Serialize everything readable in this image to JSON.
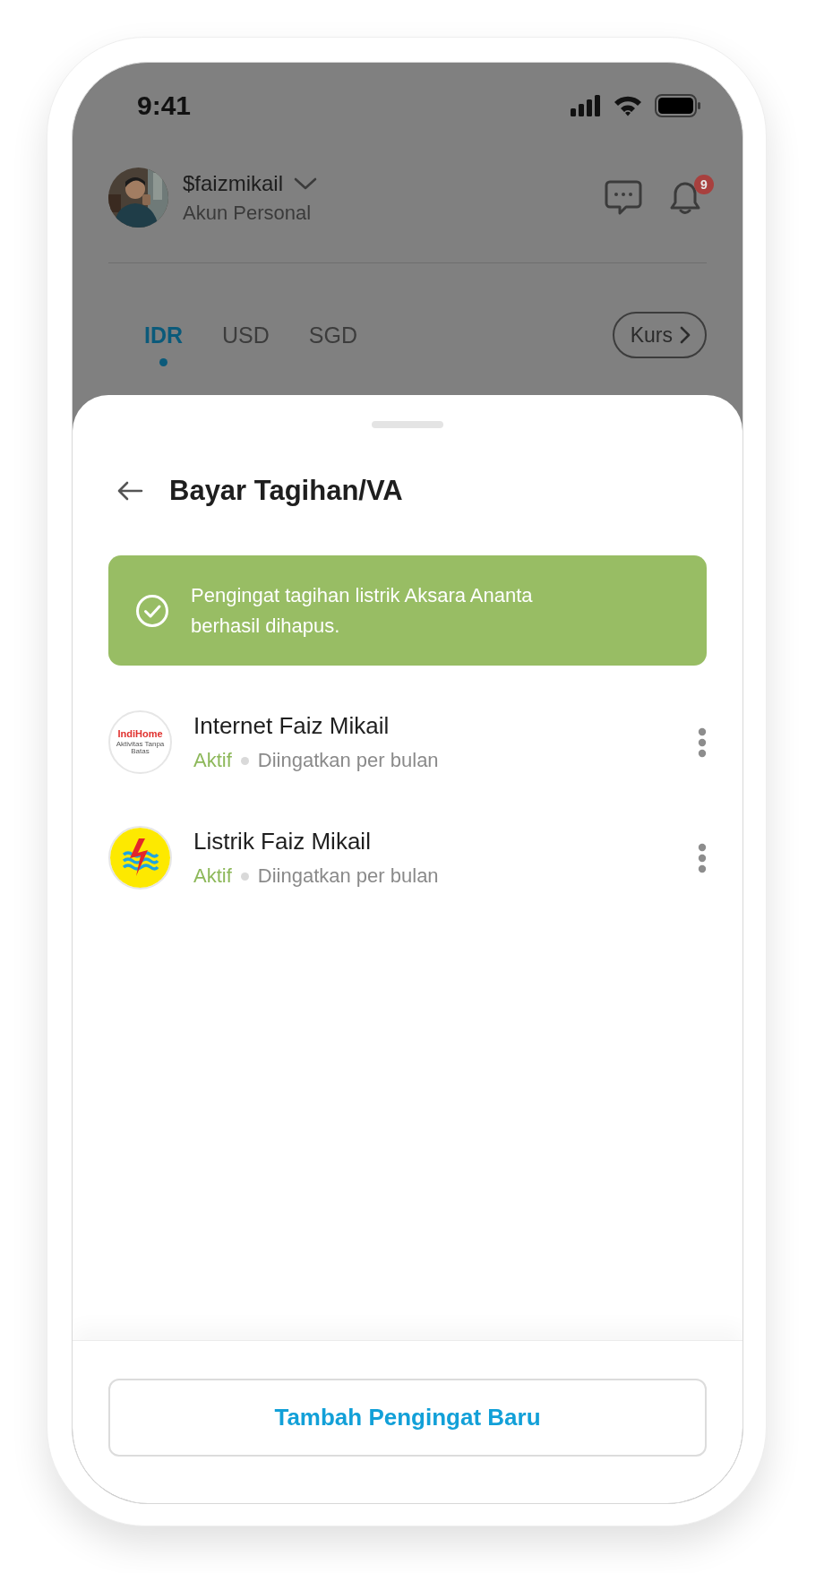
{
  "status_bar": {
    "time": "9:41"
  },
  "account": {
    "username": "$faizmikail",
    "type": "Akun Personal",
    "notification_count": "9"
  },
  "currency_tabs": [
    {
      "label": "IDR",
      "selected": true
    },
    {
      "label": "USD",
      "selected": false
    },
    {
      "label": "SGD",
      "selected": false
    }
  ],
  "rates_button": {
    "label": "Kurs"
  },
  "sheet": {
    "title": "Bayar Tagihan/VA",
    "toast": {
      "message": "Pengingat tagihan listrik Aksara Ananta berhasil dihapus."
    },
    "reminders": [
      {
        "name": "Internet Faiz Mikail",
        "status": "Aktif",
        "active": true,
        "frequency": "Diingatkan per bulan",
        "logo": {
          "kind": "indihome",
          "text": "IndiHome",
          "tagline": "Aktivitas Tanpa Batas"
        }
      },
      {
        "name": "Listrik Faiz Mikail",
        "status": "Aktif",
        "active": true,
        "frequency": "Diingatkan per bulan",
        "logo": {
          "kind": "pln"
        }
      }
    ],
    "add_button": {
      "label": "Tambah Pengingat Baru"
    }
  }
}
